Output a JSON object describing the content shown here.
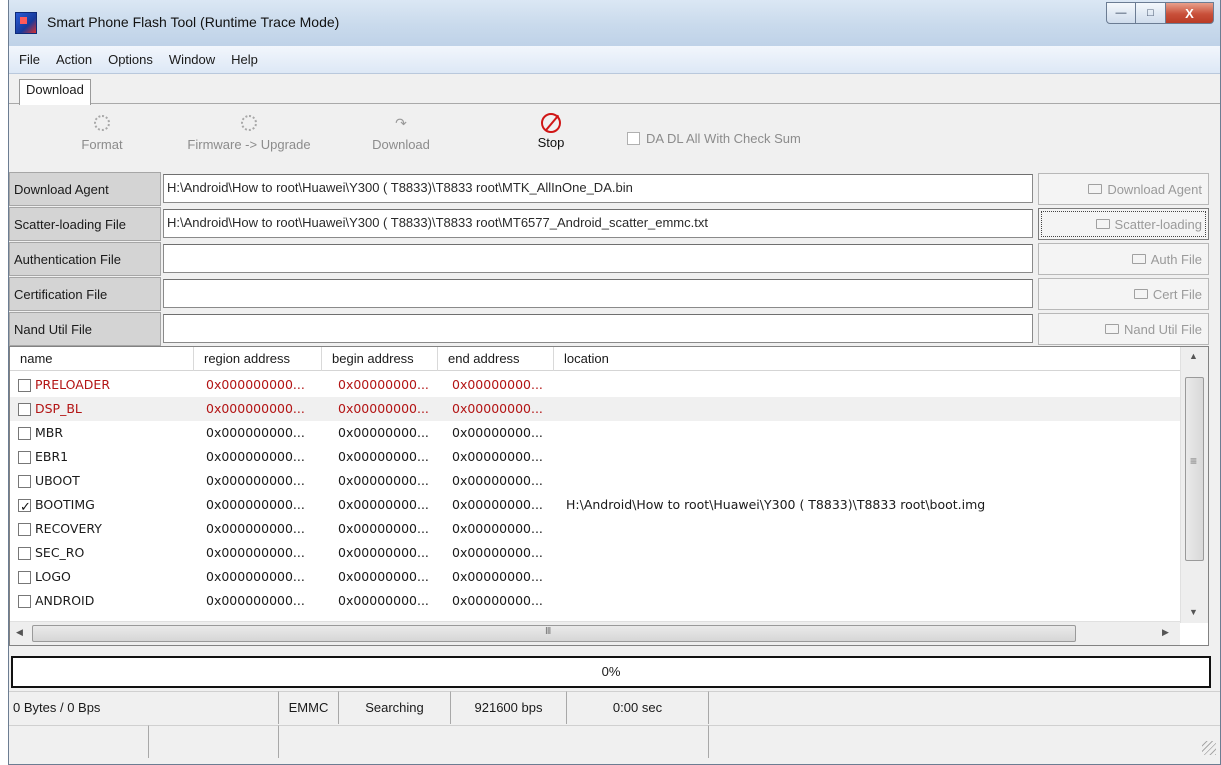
{
  "window": {
    "title": "Smart Phone Flash Tool (Runtime Trace Mode)",
    "buttons": {
      "minimize": "—",
      "maximize": "□",
      "close": "X"
    }
  },
  "menu": [
    "File",
    "Action",
    "Options",
    "Window",
    "Help"
  ],
  "tabs": [
    "Download"
  ],
  "toolbar": {
    "format": "Format",
    "firmware_upgrade": "Firmware -> Upgrade",
    "download": "Download",
    "stop": "Stop",
    "checksum": "DA DL All With Check Sum",
    "checksum_checked": false
  },
  "files": [
    {
      "label": "Download Agent",
      "value": "H:\\Android\\How to root\\Huawei\\Y300 ( T8833)\\T8833 root\\MTK_AllInOne_DA.bin",
      "button": "Download Agent"
    },
    {
      "label": "Scatter-loading File",
      "value": "H:\\Android\\How to root\\Huawei\\Y300 ( T8833)\\T8833 root\\MT6577_Android_scatter_emmc.txt",
      "button": "Scatter-loading"
    },
    {
      "label": "Authentication File",
      "value": "",
      "button": "Auth File"
    },
    {
      "label": "Certification File",
      "value": "",
      "button": "Cert File"
    },
    {
      "label": "Nand Util File",
      "value": "",
      "button": "Nand Util File"
    }
  ],
  "table": {
    "columns": [
      "name",
      "region address",
      "begin address",
      "end address",
      "location"
    ],
    "rows": [
      {
        "name": "PRELOADER",
        "region": "0x000000000...",
        "begin": "0x00000000...",
        "end": "0x00000000...",
        "location": "",
        "checked": false,
        "red": true
      },
      {
        "name": "DSP_BL",
        "region": "0x000000000...",
        "begin": "0x00000000...",
        "end": "0x00000000...",
        "location": "",
        "checked": false,
        "red": true
      },
      {
        "name": "MBR",
        "region": "0x000000000...",
        "begin": "0x00000000...",
        "end": "0x00000000...",
        "location": "",
        "checked": false,
        "red": false
      },
      {
        "name": "EBR1",
        "region": "0x000000000...",
        "begin": "0x00000000...",
        "end": "0x00000000...",
        "location": "",
        "checked": false,
        "red": false
      },
      {
        "name": "UBOOT",
        "region": "0x000000000...",
        "begin": "0x00000000...",
        "end": "0x00000000...",
        "location": "",
        "checked": false,
        "red": false
      },
      {
        "name": "BOOTIMG",
        "region": "0x000000000...",
        "begin": "0x00000000...",
        "end": "0x00000000...",
        "location": "H:\\Android\\How to root\\Huawei\\Y300 ( T8833)\\T8833 root\\boot.img",
        "checked": true,
        "red": false
      },
      {
        "name": "RECOVERY",
        "region": "0x000000000...",
        "begin": "0x00000000...",
        "end": "0x00000000...",
        "location": "",
        "checked": false,
        "red": false
      },
      {
        "name": "SEC_RO",
        "region": "0x000000000...",
        "begin": "0x00000000...",
        "end": "0x00000000...",
        "location": "",
        "checked": false,
        "red": false
      },
      {
        "name": "LOGO",
        "region": "0x000000000...",
        "begin": "0x00000000...",
        "end": "0x00000000...",
        "location": "",
        "checked": false,
        "red": false
      },
      {
        "name": "ANDROID",
        "region": "0x000000000...",
        "begin": "0x00000000...",
        "end": "0x00000000...",
        "location": "",
        "checked": false,
        "red": false
      }
    ]
  },
  "progress": {
    "percent": 0,
    "label": "0%"
  },
  "status": {
    "transfer": "0 Bytes / 0 Bps",
    "storage": "EMMC",
    "state": "Searching",
    "baud": "921600 bps",
    "time": "0:00 sec"
  },
  "colors": {
    "red_rows": "#b31414",
    "stop": "#d01616"
  }
}
